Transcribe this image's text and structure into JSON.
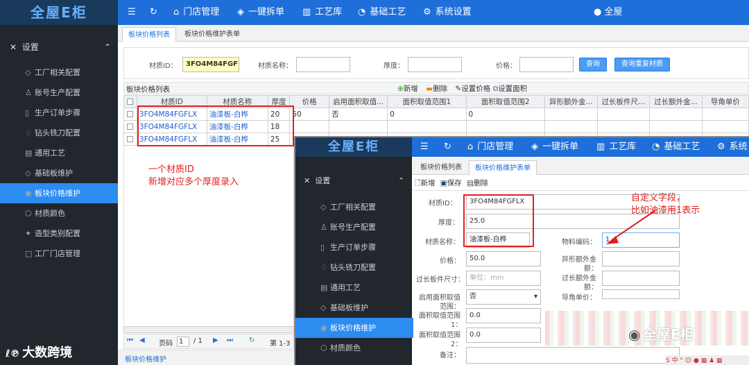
{
  "app": {
    "logo": "全屋E柜",
    "user": "全屋"
  },
  "nav": [
    {
      "icon": "☰",
      "label": ""
    },
    {
      "icon": "↻",
      "label": ""
    },
    {
      "icon": "⌂",
      "label": "门店管理"
    },
    {
      "icon": "◈",
      "label": "一键拆单"
    },
    {
      "icon": "▥",
      "label": "工艺库"
    },
    {
      "icon": "◔",
      "label": "基础工艺"
    },
    {
      "icon": "⚙",
      "label": "系统设置"
    }
  ],
  "nav2": [
    {
      "icon": "☰",
      "label": ""
    },
    {
      "icon": "↻",
      "label": ""
    },
    {
      "icon": "⌂",
      "label": "门店管理"
    },
    {
      "icon": "◈",
      "label": "一键拆单"
    },
    {
      "icon": "▥",
      "label": "工艺库"
    },
    {
      "icon": "◔",
      "label": "基础工艺"
    },
    {
      "icon": "⚙",
      "label": "系统"
    }
  ],
  "sidebar": {
    "section": "设置",
    "items": [
      "工厂相关配置",
      "账号生产配置",
      "生产订单步骤",
      "钻头铣刀配置",
      "通用工艺",
      "基础板维护",
      "板块价格维护",
      "材质颜色",
      "造型类别配置",
      "工厂门店管理"
    ]
  },
  "sidebar2": {
    "section": "设置",
    "items": [
      "工厂相关配置",
      "账号生产配置",
      "生产订单步骤",
      "钻头铣刀配置",
      "通用工艺",
      "基础板维护",
      "板块价格维护",
      "材质颜色"
    ]
  },
  "tabs": [
    "板块价格列表",
    "板块价格维护表单"
  ],
  "search": {
    "material_id_label": "材质ID：",
    "material_id_value": "3FO4M84FGFLX",
    "name_label": "材质名称：",
    "thickness_label": "厚度：",
    "price_label": "价格：",
    "query_btn": "查询",
    "dup_btn": "查询重复材质"
  },
  "list": {
    "title": "板块价格列表",
    "add": "新增",
    "del": "删除",
    "set_price": "设置价格",
    "set_area": "设置面积",
    "columns": [
      "材质ID",
      "材质名称",
      "厚度",
      "价格",
      "启用面积取值...",
      "面积取值范围1",
      "面积取值范围2",
      "异形额外金...",
      "过长板件尺...",
      "过长额外金...",
      "导角单价"
    ],
    "rows": [
      {
        "id": "3FO4M84FGFLX",
        "name": "油漆板-白桦",
        "thick": "20",
        "price": "50",
        "enable": "否",
        "r1": "0",
        "r2": "0"
      },
      {
        "id": "3FO4M84FGFLX",
        "name": "油漆板-白桦",
        "thick": "18",
        "price": "",
        "enable": "",
        "r1": "",
        "r2": ""
      },
      {
        "id": "3FO4M84FGFLX",
        "name": "油漆板-白桦",
        "thick": "25",
        "price": "",
        "enable": "",
        "r1": "",
        "r2": ""
      }
    ],
    "pager": {
      "page_label": "页码",
      "page": "1",
      "total": "/ 1",
      "info": "第 1-3"
    }
  },
  "annotation1": {
    "line1": "一个材质ID",
    "line2": "新增对应多个厚度录入"
  },
  "annotation2": {
    "line1": "自定义字段，",
    "line2": "比如油漆用1表示"
  },
  "form": {
    "add": "新增",
    "save": "保存",
    "del": "删除",
    "material_id_label": "材质ID：",
    "material_id": "3FO4M84FGFLX",
    "thickness_label": "厚度：",
    "thickness": "25.0",
    "name_label": "材质名称：",
    "name": "油漆板-白桦",
    "code_label": "物料编码：",
    "code": "1",
    "price_label": "价格：",
    "price": "50.0",
    "special_label1": "异形额外金",
    "special_label2": "额：",
    "long_size_label": "过长板件尺寸：",
    "long_size_ph": "单位：mm",
    "long_extra_label1": "过长额外金",
    "long_extra_label2": "额：",
    "enable_label1": "启用面积取值",
    "enable_label2": "范围：",
    "enable": "否",
    "bevel_label": "导角单价：",
    "r1_label1": "面积取值范围",
    "r1_label2": "1：",
    "r1": "0.0",
    "r2_label1": "面积取值范围",
    "r2_label2": "2：",
    "r2": "0.0",
    "note_label": "备注："
  },
  "footer": {
    "breadcrumb": "板块价格维护"
  },
  "watermark": {
    "left": "大数跨境",
    "right": "全屋E柜"
  }
}
